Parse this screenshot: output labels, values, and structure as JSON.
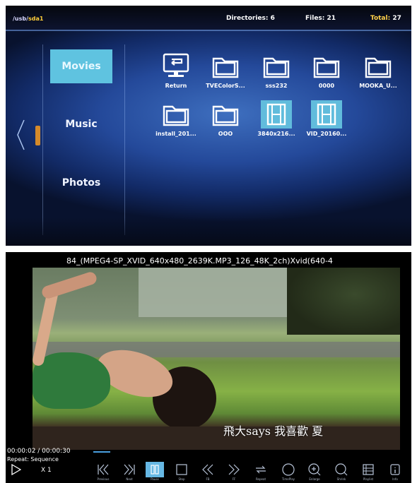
{
  "browser": {
    "path": {
      "prefix": "/usb/",
      "current": "sda1"
    },
    "directories": "Directories: 6",
    "files": "Files: 21",
    "total_label": "Total:",
    "total_value": "27",
    "categories": [
      "Movies",
      "Music",
      "Photos"
    ],
    "selected_category": "Movies",
    "items": [
      {
        "label": "Return",
        "icon": "return-icon"
      },
      {
        "label": "TVEColorS...",
        "icon": "folder-icon"
      },
      {
        "label": "sss232",
        "icon": "folder-icon"
      },
      {
        "label": "0000",
        "icon": "folder-icon"
      },
      {
        "label": "MOOKA_U...",
        "icon": "folder-icon"
      },
      {
        "label": "install_201...",
        "icon": "folder-icon"
      },
      {
        "label": "ΟΟΟ",
        "icon": "folder-icon"
      },
      {
        "label": "3840x216...",
        "icon": "video-file-icon"
      },
      {
        "label": "VID_20160...",
        "icon": "video-file-icon"
      }
    ],
    "colors": {
      "selected": "#5fc3e0",
      "accent": "#ffd14a"
    }
  },
  "player": {
    "file_info": "84_(MPEG4-SP_XVID_640x480_2639K.MP3_126_48K_2ch)Xvid(640-4",
    "subtitle": "飛大says 我喜歡 夏",
    "time": "00:00:02 / 00:00:30",
    "repeat": "Repeat: Sequence",
    "speed": "X 1",
    "controls": [
      {
        "icon": "previous-icon",
        "caption": "Previous"
      },
      {
        "icon": "next-icon",
        "caption": "Next"
      },
      {
        "icon": "pause-icon",
        "caption": "Pause"
      },
      {
        "icon": "stop-icon",
        "caption": "Stop"
      },
      {
        "icon": "rewind-icon",
        "caption": "FB"
      },
      {
        "icon": "fast-forward-icon",
        "caption": "FF"
      },
      {
        "icon": "repeat-icon",
        "caption": "Repeat"
      },
      {
        "icon": "timeplay-icon",
        "caption": "TimePlay"
      },
      {
        "icon": "zoom-in-icon",
        "caption": "Enlarge"
      },
      {
        "icon": "zoom-out-icon",
        "caption": "Shrink"
      },
      {
        "icon": "playlist-icon",
        "caption": "Playlist"
      },
      {
        "icon": "info-icon",
        "caption": "Info"
      }
    ],
    "active_control": "pause-icon"
  }
}
